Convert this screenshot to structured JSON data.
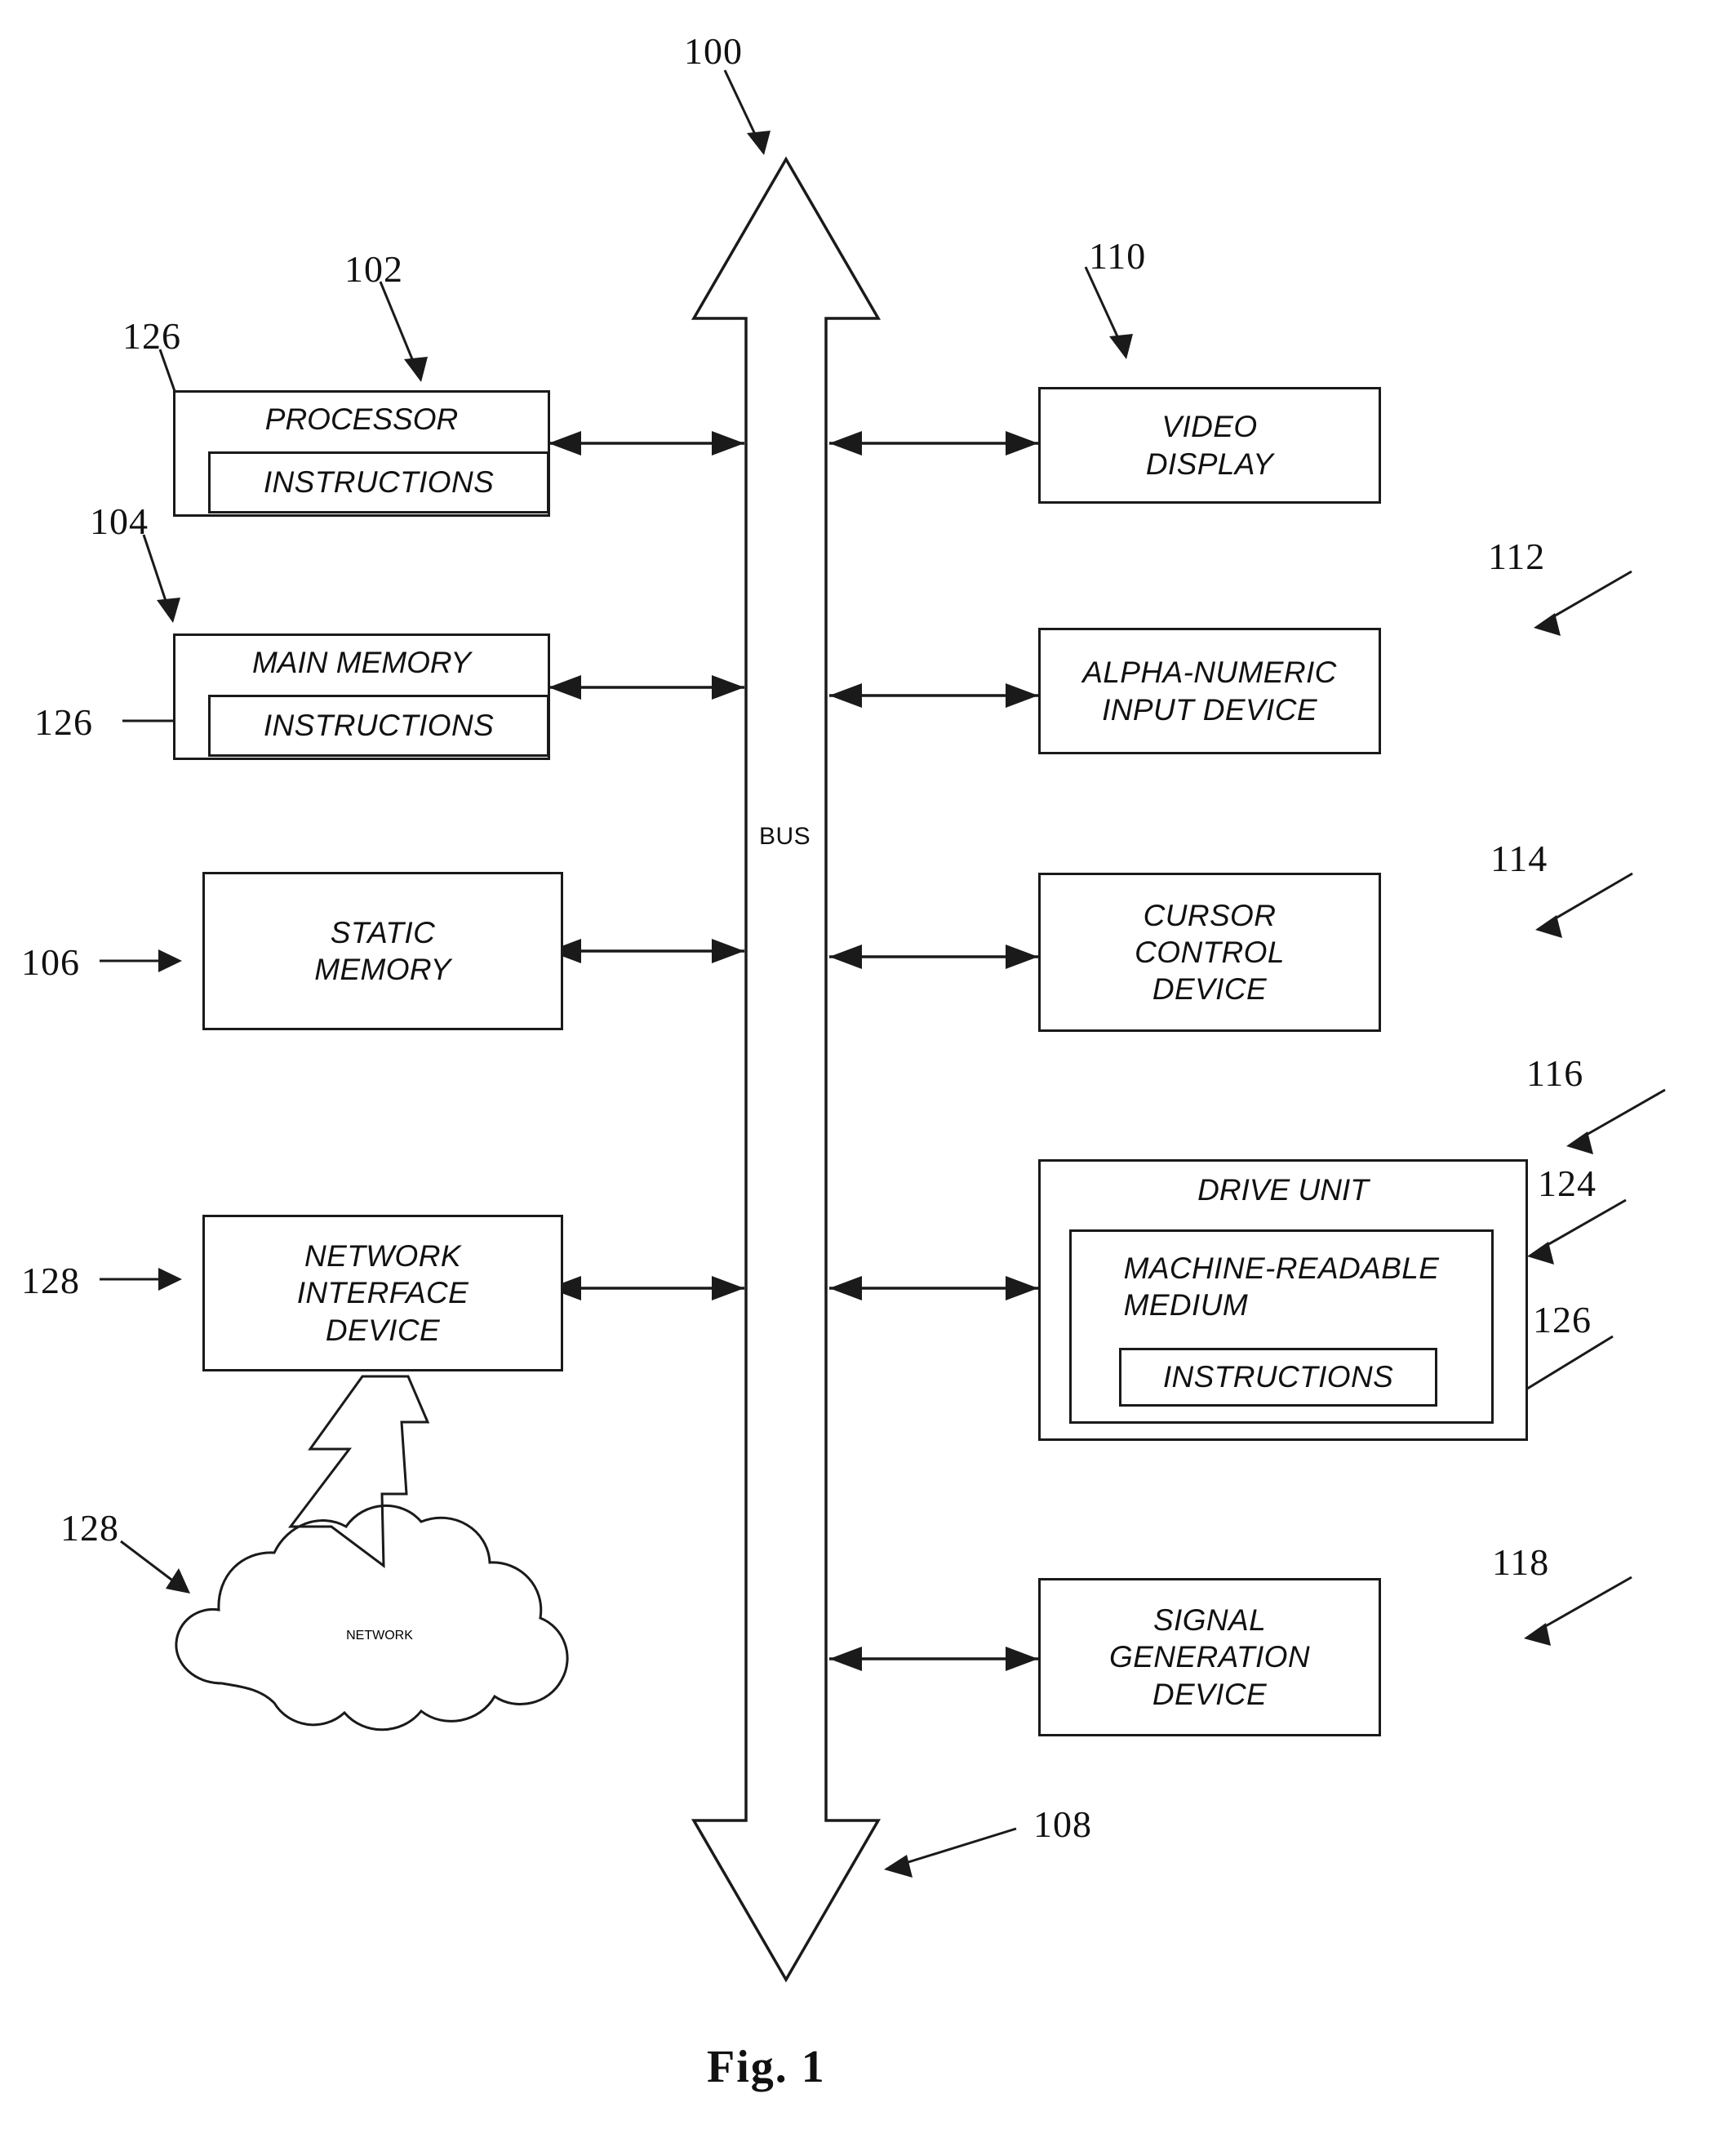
{
  "figure": {
    "caption": "Fig. 1",
    "system_ref": "100",
    "bus_label": "BUS",
    "bus_ref": "108"
  },
  "left_column": {
    "processor": {
      "title": "PROCESSOR",
      "ref": "102",
      "instructions_label": "INSTRUCTIONS",
      "instructions_ref": "126"
    },
    "main_memory": {
      "title": "MAIN MEMORY",
      "ref": "104",
      "instructions_label": "INSTRUCTIONS",
      "instructions_ref": "126"
    },
    "static_memory": {
      "title": "STATIC\nMEMORY",
      "ref": "106"
    },
    "network_interface": {
      "title": "NETWORK\nINTERFACE\nDEVICE",
      "ref": "128"
    },
    "network_cloud": {
      "title": "NETWORK",
      "ref": "128"
    }
  },
  "right_column": {
    "video_display": {
      "title": "VIDEO\nDISPLAY",
      "ref": "110"
    },
    "alpha_numeric_input": {
      "title": "ALPHA-NUMERIC\nINPUT DEVICE",
      "ref": "112"
    },
    "cursor_control": {
      "title": "CURSOR\nCONTROL\nDEVICE",
      "ref": "114"
    },
    "drive_unit": {
      "title": "DRIVE UNIT",
      "ref": "116",
      "machine_readable_medium": {
        "title": "MACHINE-READABLE\nMEDIUM",
        "ref": "124"
      },
      "instructions": {
        "title": "INSTRUCTIONS",
        "ref": "126"
      }
    },
    "signal_generation": {
      "title": "SIGNAL\nGENERATION\nDEVICE",
      "ref": "118"
    }
  },
  "colors": {
    "ink": "#1a1a1a",
    "paper": "#ffffff"
  }
}
